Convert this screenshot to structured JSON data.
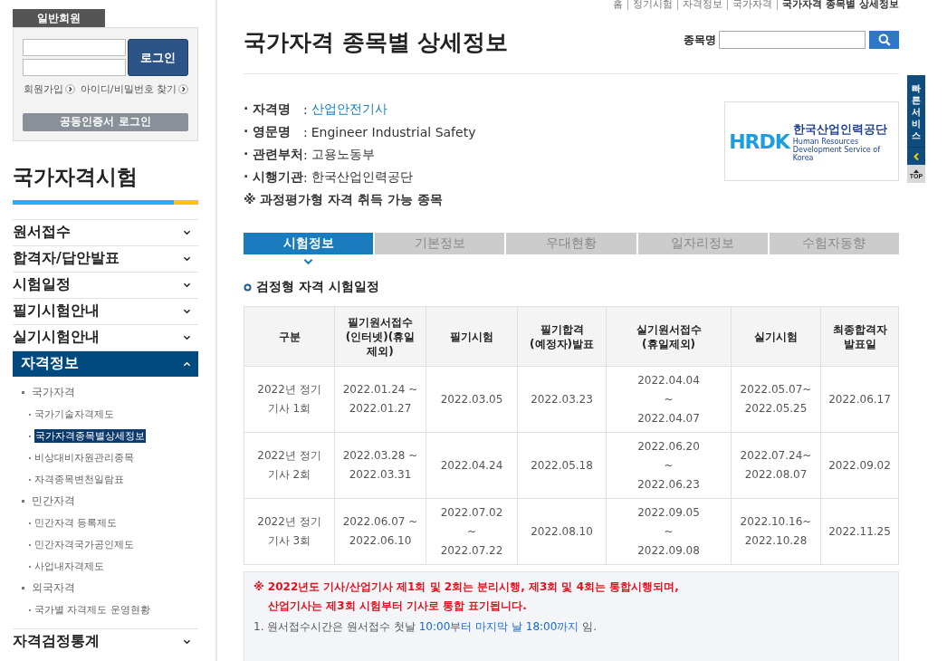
{
  "sidebar": {
    "member_tab": "일반회원",
    "login_button": "로그인",
    "links": [
      "회원가입",
      "아이디/비밀번호 찾기"
    ],
    "cert_login_button": "공동인증서 로그인",
    "title": "국가자격시험",
    "menu": [
      {
        "label": "원서접수",
        "expanded": false
      },
      {
        "label": "합격자/답안발표",
        "expanded": false
      },
      {
        "label": "시험일정",
        "expanded": false
      },
      {
        "label": "필기시험안내",
        "expanded": false
      },
      {
        "label": "실기시험안내",
        "expanded": false
      },
      {
        "label": "자격정보",
        "expanded": true,
        "children": [
          {
            "label": "국가자격",
            "children": [
              {
                "label": "국가기술자격제도",
                "selected": false
              },
              {
                "label": "국가자격종목별상세정보",
                "selected": true
              },
              {
                "label": "비상대비자원관리종목",
                "selected": false
              },
              {
                "label": "자격종목변천일람표",
                "selected": false
              }
            ]
          },
          {
            "label": "민간자격",
            "children": [
              {
                "label": "민간자격 등록제도",
                "selected": false
              },
              {
                "label": "민간자격국가공인제도",
                "selected": false
              },
              {
                "label": "사업내자격제도",
                "selected": false
              }
            ]
          },
          {
            "label": "외국자격",
            "children": [
              {
                "label": "국가별 자격제도 운영현황",
                "selected": false
              }
            ]
          }
        ]
      },
      {
        "label": "자격검정통계",
        "expanded": false
      }
    ]
  },
  "breadcrumb": [
    "홈",
    "정기시험",
    "자격정보",
    "국가자격",
    "국가자격 종목별 상세정보"
  ],
  "page_title": "국가자격 종목별 상세정보",
  "search": {
    "label": "종목명"
  },
  "info": [
    {
      "label": "· 자격명",
      "sep": ":",
      "value": "산업안전기사",
      "kind": "link"
    },
    {
      "label": "· 영문명",
      "sep": ":",
      "value": "Engineer Industrial Safety",
      "kind": "text"
    },
    {
      "label": "· 관련부처",
      "sep": ":",
      "value": "고용노동부",
      "kind": "text"
    },
    {
      "label": "· 시행기관",
      "sep": ":",
      "value": "한국산업인력공단",
      "kind": "text"
    }
  ],
  "info_note": "※ 과정평가형 자격 취득 가능 종목",
  "logo": {
    "mark": "HRDK",
    "name": "한국산업인력공단",
    "subtitle": "Human Resources Development Service of Korea"
  },
  "tabs": [
    {
      "label": "시험정보",
      "selected": true
    },
    {
      "label": "기본정보",
      "selected": false
    },
    {
      "label": "우대현황",
      "selected": false
    },
    {
      "label": "일자리정보",
      "selected": false
    },
    {
      "label": "수험자동향",
      "selected": false
    }
  ],
  "section_title": "검정형 자격 시험일정",
  "table": {
    "columns": [
      "구분",
      "필기원서접수\n(인터넷)(휴일\n제외)",
      "필기시험",
      "필기합격\n(예정자)발표",
      "실기원서접수\n(휴일제외)",
      "실기시험",
      "최종합격자\n발표일"
    ],
    "rows": [
      [
        "2022년 정기\n기사 1회",
        "2022.01.24 ~\n2022.01.27",
        "2022.03.05",
        "2022.03.23",
        "2022.04.04\n~\n2022.04.07",
        "2022.05.07~\n2022.05.25",
        "2022.06.17"
      ],
      [
        "2022년 정기\n기사 2회",
        "2022.03.28 ~\n2022.03.31",
        "2022.04.24",
        "2022.05.18",
        "2022.06.20\n~\n2022.06.23",
        "2022.07.24~\n2022.08.07",
        "2022.09.02"
      ],
      [
        "2022년 정기\n기사 3회",
        "2022.06.07 ~\n2022.06.10",
        "2022.07.02\n~\n2022.07.22",
        "2022.08.10",
        "2022.09.05\n~\n2022.09.08",
        "2022.10.16~\n2022.10.28",
        "2022.11.25"
      ]
    ]
  },
  "notes": [
    {
      "kind": "warning",
      "lines": [
        "※ 2022년도 기사/산업기사 제1회 및 2회는 분리시행, 제3회 및 4회는 통합시행되며,",
        "산업기사는 제3회 시험부터 기사로 통합 표기됩니다."
      ]
    },
    {
      "kind": "plain",
      "parts": [
        {
          "text": "1. 원서접수시간은 원서접수 첫날 ",
          "highlight": false
        },
        {
          "text": "10:00부터 마지막 날 18:00까지",
          "highlight": true
        },
        {
          "text": " 임.",
          "highlight": false
        }
      ]
    }
  ],
  "quick_bar": {
    "title": "빠른서비스",
    "top": "TOP"
  }
}
